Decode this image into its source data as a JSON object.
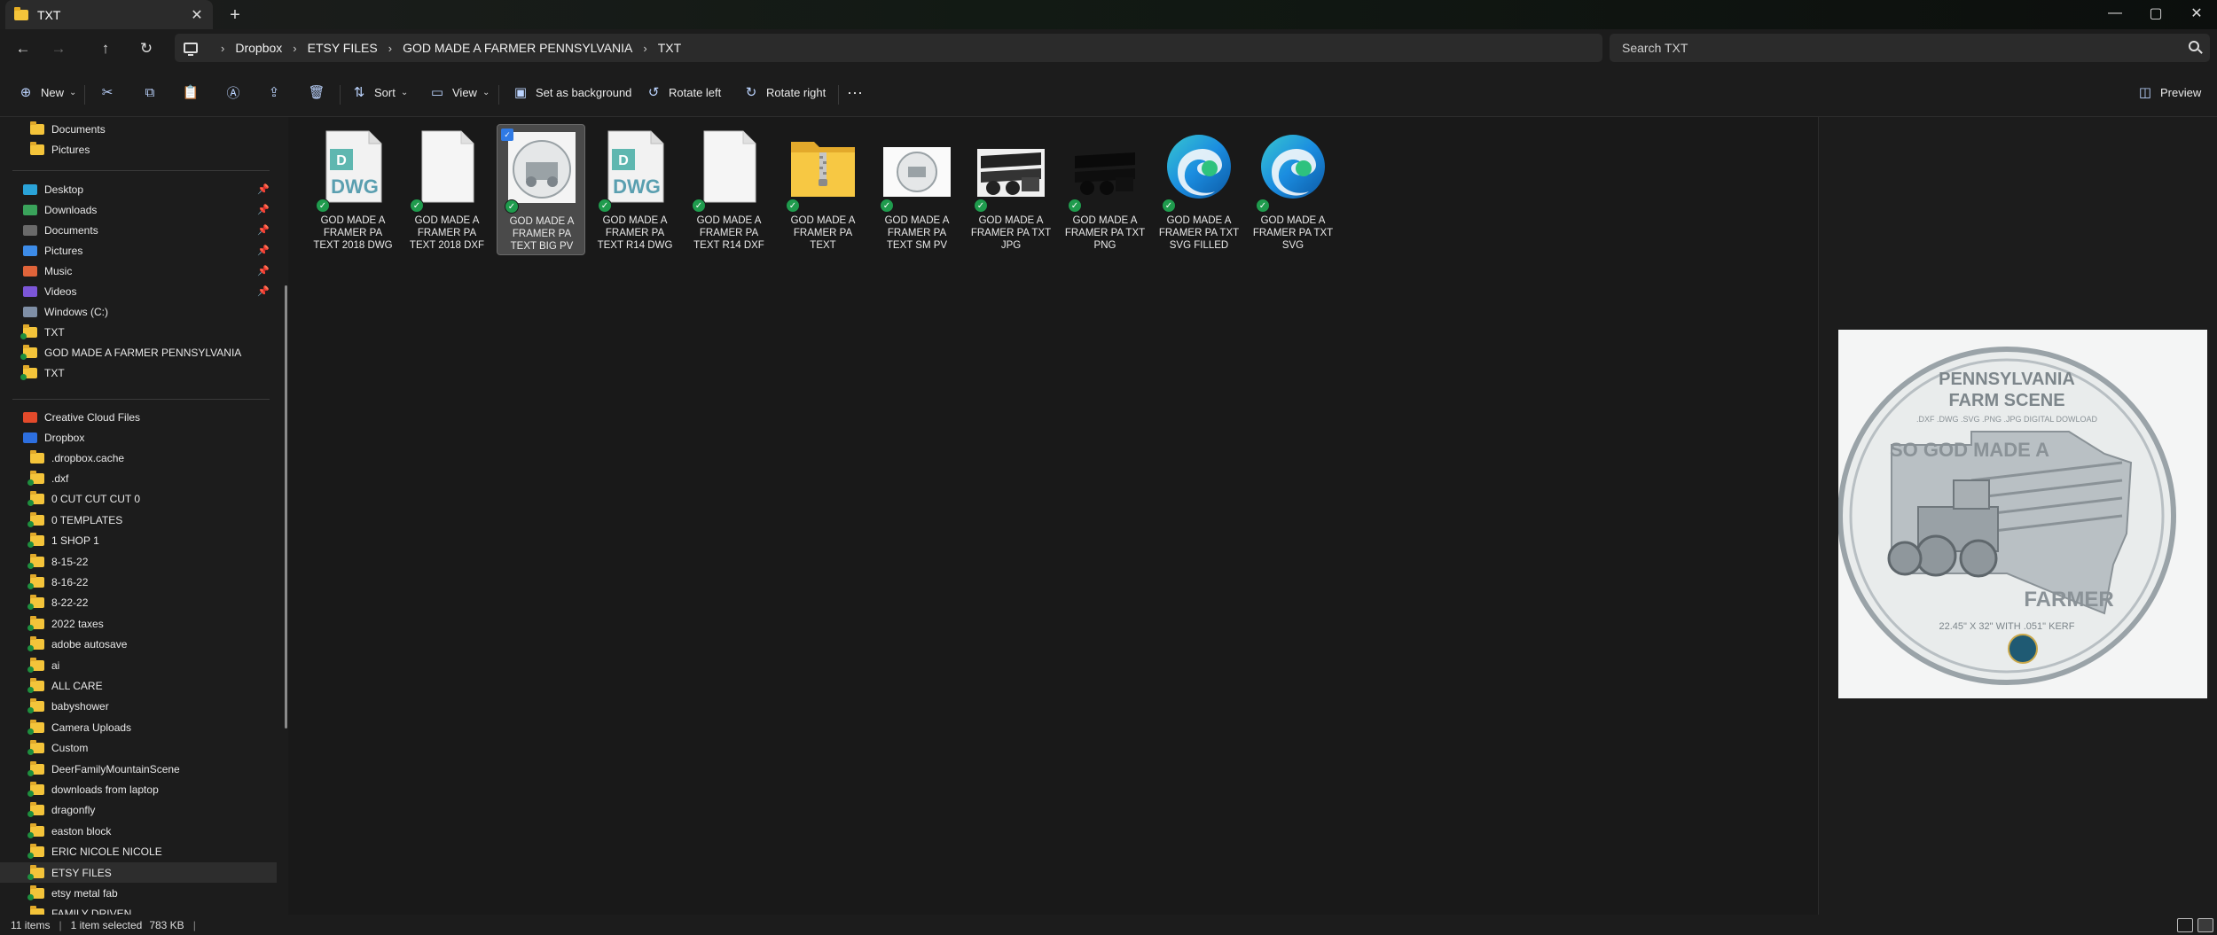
{
  "window": {
    "tab_title": "TXT",
    "tab_close": "✕",
    "new_tab": "+",
    "controls": {
      "minimize": "—",
      "maximize": "▢",
      "close": "✕"
    }
  },
  "nav": {
    "back": "←",
    "forward": "→",
    "up": "↑",
    "refresh": "↻"
  },
  "address": {
    "separator": "›",
    "crumbs": [
      "Dropbox",
      "ETSY FILES",
      "GOD MADE A FARMER PENNSYLVANIA",
      "TXT"
    ]
  },
  "search": {
    "placeholder": "Search TXT"
  },
  "toolbar": {
    "new_label": "New",
    "sort_label": "Sort",
    "view_label": "View",
    "set_background_label": "Set as background",
    "rotate_left_label": "Rotate left",
    "rotate_right_label": "Rotate right",
    "more_label": "···",
    "preview_label": "Preview"
  },
  "sidebar": {
    "top_items": [
      {
        "label": "Documents",
        "icon": "folder-icon"
      },
      {
        "label": "Pictures",
        "icon": "folder-icon"
      }
    ],
    "quick_access": [
      {
        "label": "Desktop",
        "icon": "desktop-icon",
        "pinned": true
      },
      {
        "label": "Downloads",
        "icon": "downloads-icon",
        "pinned": true
      },
      {
        "label": "Documents",
        "icon": "documents-icon",
        "pinned": true
      },
      {
        "label": "Pictures",
        "icon": "pictures-icon",
        "pinned": true
      },
      {
        "label": "Music",
        "icon": "music-icon",
        "pinned": true
      },
      {
        "label": "Videos",
        "icon": "videos-icon",
        "pinned": true
      },
      {
        "label": "Windows (C:)",
        "icon": "drive-icon",
        "pinned": false
      },
      {
        "label": "TXT",
        "icon": "folder-icon",
        "pinned": false
      },
      {
        "label": "GOD MADE A FARMER PENNSYLVANIA",
        "icon": "folder-icon",
        "pinned": false
      },
      {
        "label": "TXT",
        "icon": "folder-icon",
        "pinned": false
      }
    ],
    "pin_glyph": "📌",
    "cloud": [
      {
        "label": "Creative Cloud Files",
        "icon": "creative-cloud-icon"
      },
      {
        "label": "Dropbox",
        "icon": "dropbox-icon"
      }
    ],
    "dropbox_folders": [
      ".dropbox.cache",
      ".dxf",
      "0 CUT CUT CUT 0",
      "0 TEMPLATES",
      "1 SHOP 1",
      "8-15-22",
      "8-16-22",
      "8-22-22",
      "2022 taxes",
      "adobe autosave",
      "ai",
      "ALL CARE",
      "babyshower",
      "Camera Uploads",
      "Custom",
      "DeerFamilyMountainScene",
      "downloads from laptop",
      "dragonfly",
      "easton block",
      "ERIC NICOLE NICOLE",
      "ETSY FILES",
      "etsy metal fab",
      "FAMILY DRIVEN"
    ],
    "selected_folder": "ETSY FILES"
  },
  "files": [
    {
      "name": "GOD MADE A FRAMER PA TEXT 2018 DWG",
      "type": "dwg"
    },
    {
      "name": "GOD MADE A FRAMER PA TEXT 2018 DXF",
      "type": "blank"
    },
    {
      "name": "GOD MADE A FRAMER PA TEXT BIG PV",
      "type": "image-preview",
      "selected": true
    },
    {
      "name": "GOD MADE A FRAMER PA TEXT R14 DWG",
      "type": "dwg"
    },
    {
      "name": "GOD MADE A FRAMER PA TEXT R14 DXF",
      "type": "blank"
    },
    {
      "name": "GOD MADE A FRAMER PA TEXT",
      "type": "zip-folder"
    },
    {
      "name": "GOD MADE A FRAMER PA TEXT SM PV",
      "type": "image-small"
    },
    {
      "name": "GOD MADE A FRAMER PA TXT JPG",
      "type": "image-jpg"
    },
    {
      "name": "GOD MADE A FRAMER PA TXT PNG",
      "type": "image-png"
    },
    {
      "name": "GOD MADE A FRAMER PA TXT SVG FILLED",
      "type": "edge"
    },
    {
      "name": "GOD MADE A FRAMER PA TXT SVG",
      "type": "edge"
    }
  ],
  "dwg_label": "DWG",
  "check_glyph": "✓",
  "preview_image": {
    "title_line1": "PENNSYLVANIA",
    "title_line2": "FARM SCENE",
    "formats": ".DXF .DWG .SVG .PNG .JPG DIGITAL DOWLOAD",
    "headline": "SO GOD MADE A",
    "footer_word": "FARMER",
    "size_text": "22.45\" X 32\" WITH .051\" KERF"
  },
  "status": {
    "items": "11 items",
    "selection": "1 item selected",
    "size": "783 KB",
    "bar": "|"
  }
}
